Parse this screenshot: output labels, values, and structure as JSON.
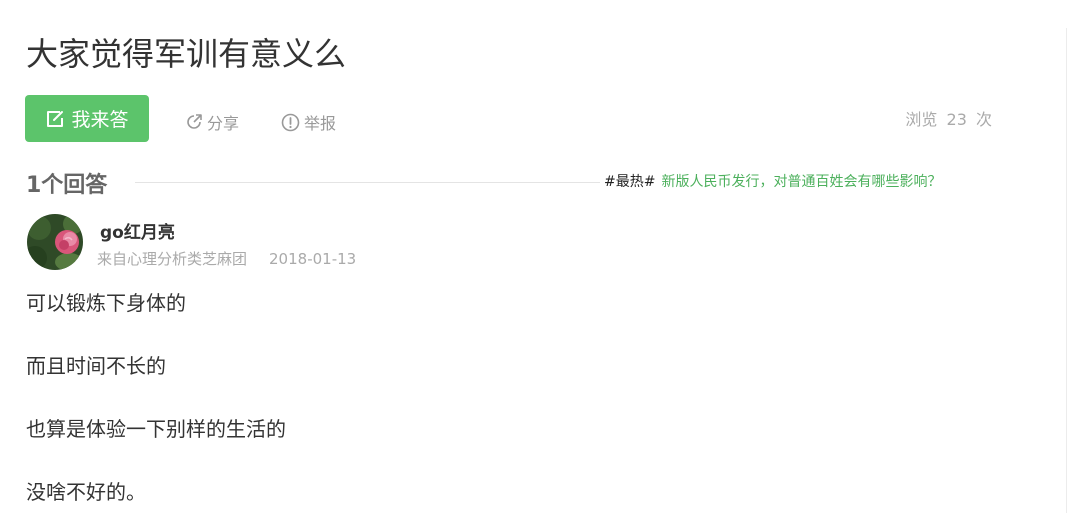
{
  "question": {
    "title": "大家觉得军训有意义么"
  },
  "actions": {
    "answer_label": "我来答",
    "share_label": "分享",
    "report_label": "举报"
  },
  "views": {
    "prefix": "浏览",
    "count": "23",
    "suffix": "次"
  },
  "answers_header": {
    "count_label": "1个回答"
  },
  "hot": {
    "tag": "#最热#",
    "link_text": "新版人民币发行，对普通百姓会有哪些影响？"
  },
  "answer": {
    "author_name": "go红月亮",
    "source": "来自心理分析类芝麻团",
    "date": "2018-01-13",
    "paragraphs": [
      "可以锻炼下身体的",
      "而且时间不长的",
      "也算是体验一下别样的生活的",
      "没啥不好的。"
    ]
  },
  "icons": {
    "answer": "edit-icon",
    "share": "share-icon",
    "report": "alert-icon"
  },
  "colors": {
    "accent": "#5cc46b",
    "link": "#4cb05c",
    "muted": "#999999"
  }
}
